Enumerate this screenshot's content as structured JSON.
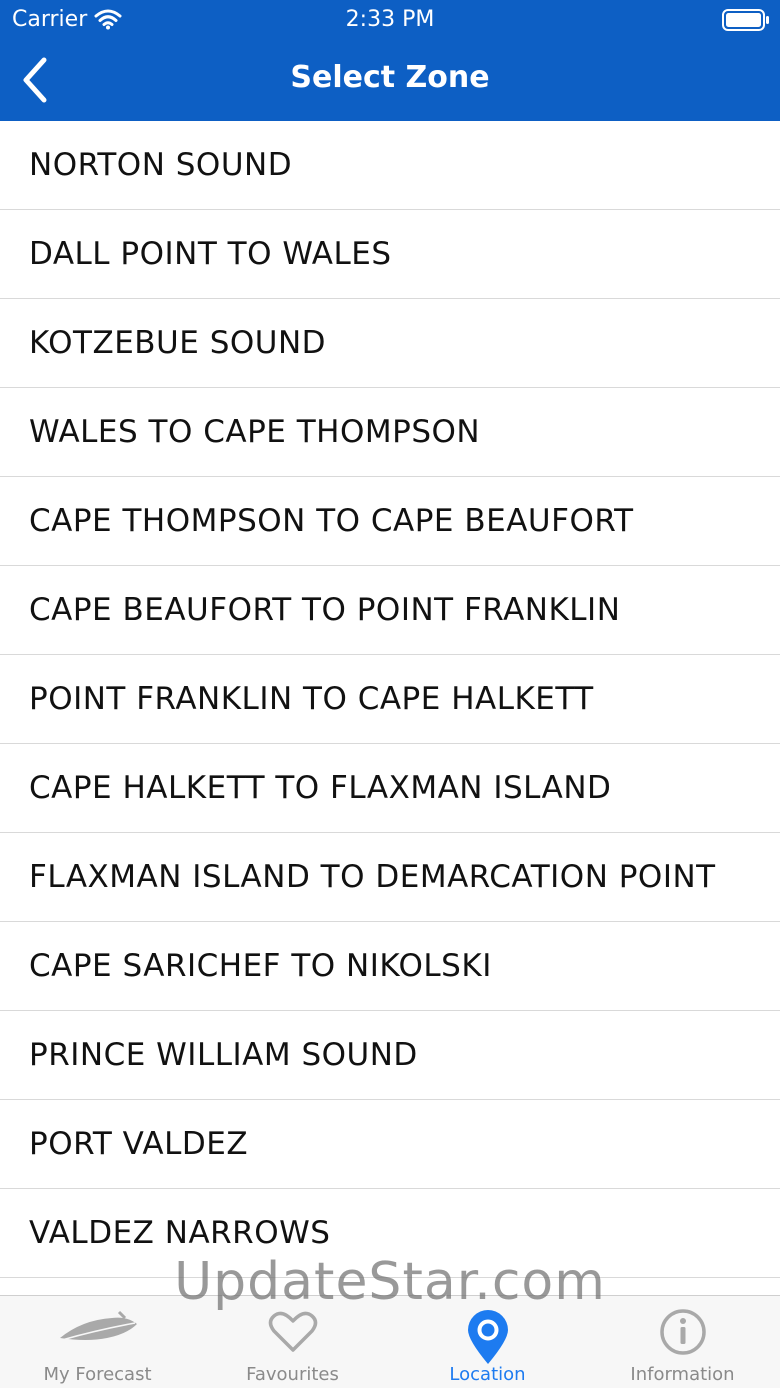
{
  "status_bar": {
    "carrier": "Carrier",
    "time": "2:33 PM"
  },
  "nav": {
    "title": "Select Zone"
  },
  "zones": [
    "NORTON SOUND",
    "DALL POINT TO WALES",
    "KOTZEBUE SOUND",
    "WALES TO CAPE THOMPSON",
    "CAPE THOMPSON TO CAPE BEAUFORT",
    "CAPE BEAUFORT TO POINT FRANKLIN",
    "POINT FRANKLIN TO CAPE HALKETT",
    "CAPE HALKETT TO FLAXMAN ISLAND",
    "FLAXMAN ISLAND TO DEMARCATION POINT",
    "CAPE SARICHEF TO NIKOLSKI",
    "PRINCE WILLIAM SOUND",
    "PORT VALDEZ",
    "VALDEZ NARROWS"
  ],
  "tabs": [
    {
      "label": "My Forecast",
      "icon": "feather-icon"
    },
    {
      "label": "Favourites",
      "icon": "heart-icon"
    },
    {
      "label": "Location",
      "icon": "location-pin-icon"
    },
    {
      "label": "Information",
      "icon": "info-icon"
    }
  ],
  "watermark": "UpdateStar.com",
  "colors": {
    "header": "#0d5fc4",
    "active_tab": "#1d7bf0",
    "inactive_tab": "#8a8a8a"
  }
}
